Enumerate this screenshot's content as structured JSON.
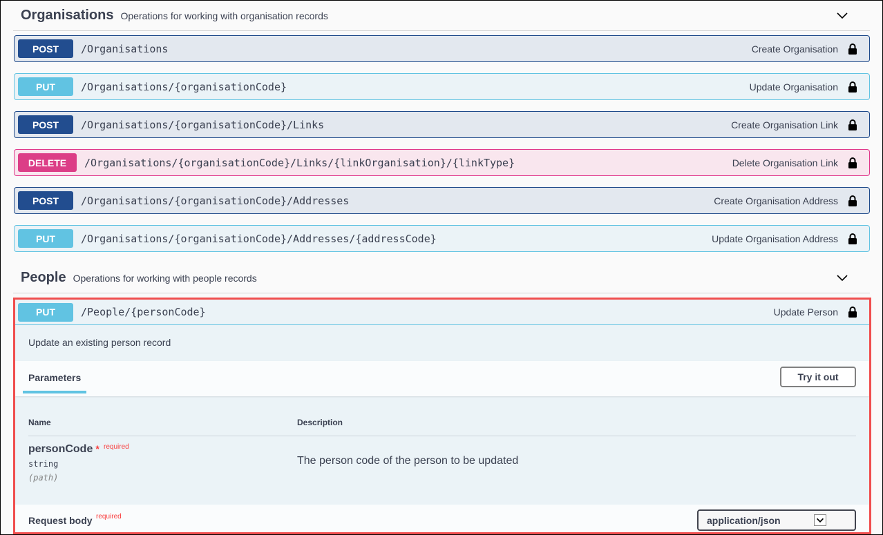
{
  "sections": [
    {
      "title": "Organisations",
      "description": "Operations for working with organisation records",
      "operations": [
        {
          "method": "POST",
          "path": "/Organisations",
          "summary": "Create Organisation"
        },
        {
          "method": "PUT",
          "path": "/Organisations/{organisationCode}",
          "summary": "Update Organisation"
        },
        {
          "method": "POST",
          "path": "/Organisations/{organisationCode}/Links",
          "summary": "Create Organisation Link"
        },
        {
          "method": "DELETE",
          "path": "/Organisations/{organisationCode}/Links/{linkOrganisation}/{linkType}",
          "summary": "Delete Organisation Link"
        },
        {
          "method": "POST",
          "path": "/Organisations/{organisationCode}/Addresses",
          "summary": "Create Organisation Address"
        },
        {
          "method": "PUT",
          "path": "/Organisations/{organisationCode}/Addresses/{addressCode}",
          "summary": "Update Organisation Address"
        }
      ]
    },
    {
      "title": "People",
      "description": "Operations for working with people records",
      "operations": [
        {
          "method": "PUT",
          "path": "/People/{personCode}",
          "summary": "Update Person",
          "description": "Update an existing person record",
          "parameters_tab": "Parameters",
          "try_it_out": "Try it out",
          "columns": {
            "name": "Name",
            "description": "Description"
          },
          "parameters": [
            {
              "name": "personCode",
              "star": "*",
              "required": "required",
              "type": "string",
              "in": "(path)",
              "description": "The person code of the person to be updated"
            }
          ],
          "request_body": {
            "label": "Request body",
            "required": "required",
            "content_type": "application/json"
          }
        }
      ]
    }
  ],
  "colors": {
    "post": "#224d8f",
    "put": "#61c3e2",
    "delete": "#dc3e87",
    "highlight": "#f04e4e"
  }
}
